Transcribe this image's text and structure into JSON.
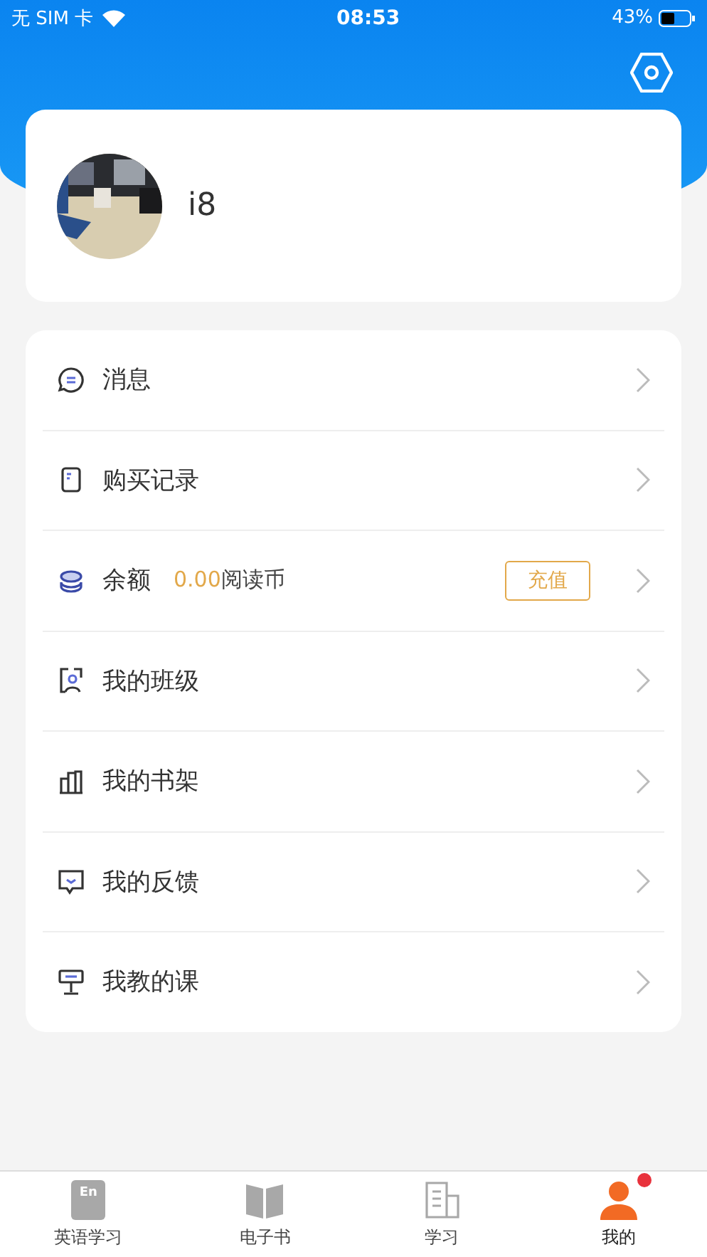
{
  "status_bar": {
    "carrier": "无 SIM 卡",
    "time": "08:53",
    "battery": "43%"
  },
  "profile": {
    "name": "i8"
  },
  "menu": [
    {
      "kind": "message",
      "label": "消息"
    },
    {
      "kind": "purchase",
      "label": "购买记录"
    },
    {
      "kind": "balance",
      "label": "余额",
      "amount": "0.00",
      "unit": "阅读币",
      "action": "充值"
    },
    {
      "kind": "class",
      "label": "我的班级"
    },
    {
      "kind": "shelf",
      "label": "我的书架"
    },
    {
      "kind": "feedback",
      "label": "我的反馈"
    },
    {
      "kind": "course",
      "label": "我教的课"
    }
  ],
  "tab_bar": [
    {
      "kind": "english",
      "label": "英语学习",
      "icon_text": "En",
      "selected": false,
      "badge": false
    },
    {
      "kind": "ebook",
      "label": "电子书",
      "selected": false,
      "badge": false
    },
    {
      "kind": "study",
      "label": "学习",
      "selected": false,
      "badge": false
    },
    {
      "kind": "me",
      "label": "我的",
      "selected": true,
      "badge": true
    }
  ]
}
